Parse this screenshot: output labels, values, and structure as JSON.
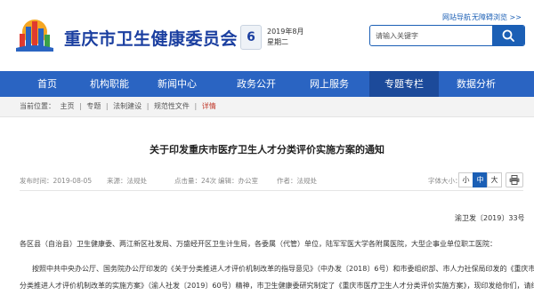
{
  "header": {
    "title": "重庆市卫生健康委员会",
    "date_day": "6",
    "date_year_month": "2019年8月",
    "date_weekday": "星期二",
    "links": {
      "nav": "网站导航",
      "accessible": "无障碍浏览 >>"
    },
    "search": {
      "placeholder": "请输入关键字",
      "icon": "search-icon"
    }
  },
  "nav": {
    "items": [
      {
        "label": "首页",
        "active": false
      },
      {
        "label": "机构职能",
        "active": false
      },
      {
        "label": "新闻中心",
        "active": false
      },
      {
        "label": "政务公开",
        "active": false
      },
      {
        "label": "网上服务",
        "active": false
      },
      {
        "label": "专题专栏",
        "active": true
      },
      {
        "label": "数据分析",
        "active": false
      }
    ]
  },
  "breadcrumb": {
    "prefix": "当前位置：",
    "items": [
      "主页",
      "专题",
      "法制建设",
      "规范性文件",
      "详情"
    ],
    "separator": "|"
  },
  "article": {
    "title": "关于印发重庆市医疗卫生人才分类评价实施方案的通知",
    "meta": {
      "published": "发布时间：2019-08-05",
      "source": "来源：法规处",
      "views": "点击量：24次",
      "editor": "编辑：办公室",
      "author": "作者：法规处"
    },
    "font_size": {
      "label": "字体大小：",
      "options": [
        "小",
        "中",
        "大"
      ],
      "selected": "中"
    },
    "doc_number": "渝卫发〔2019〕33号",
    "salutation": "各区县（自治县）卫生健康委、两江新区社发局、万盛经开区卫生计生局，各委属（代管）单位，陆军军医大学各附属医院，大型企事业单位职工医院：",
    "para1_line1": "按照中共中央办公厅、国务院办公厅印发的《关于分类推进人才评价机制改革的指导意见》（中办发〔2018〕6号）和市委组织部、市人力社保局印发的《重庆市",
    "para1_line2": "分类推进人才评价机制改革的实施方案》（渝人社发〔2019〕60号）精神，市卫生健康委研究制定了《重庆市医疗卫生人才分类评价实施方案》，现印发给你们，请结"
  },
  "colors": {
    "brand_blue": "#1b3fa0",
    "nav_blue": "#2a64c2",
    "nav_active": "#1c4a9a",
    "crumb_current": "#c0392b"
  }
}
